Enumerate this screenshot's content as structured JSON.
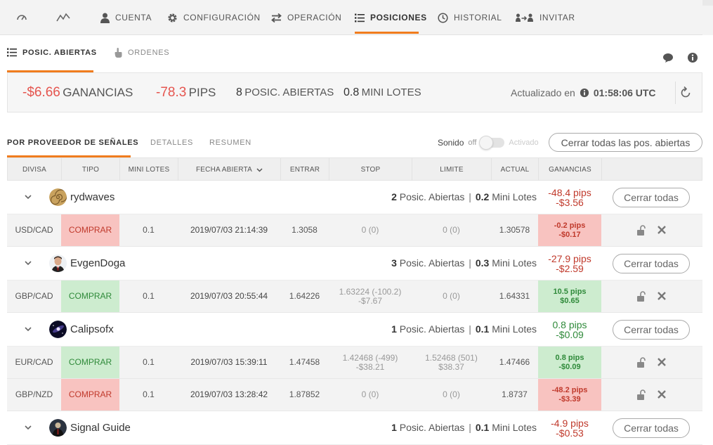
{
  "nav": {
    "items": [
      {
        "label": ""
      },
      {
        "label": ""
      },
      {
        "label": "CUENTA"
      },
      {
        "label": "CONFIGURACIÓN"
      },
      {
        "label": "OPERACIÓN"
      },
      {
        "label": "POSICIONES"
      },
      {
        "label": "HISTORIAL"
      },
      {
        "label": "INVITAR"
      }
    ]
  },
  "subtabs": {
    "open": "POSIC. ABIERTAS",
    "orders": "ORDENES"
  },
  "summary": {
    "profit_value": "-$6.66",
    "profit_label": "GANANCIAS",
    "pips_value": "-78.3",
    "pips_label": "PIPS",
    "open_count": "8",
    "open_label": "POSIC. ABIERTAS",
    "lots_value": "0.8",
    "lots_label": "MINI LOTES",
    "updated_label": "Actualizado en",
    "updated_time": "01:58:06 UTC"
  },
  "filter_tabs": {
    "by_provider": "POR PROVEEDOR DE SEÑALES",
    "details": "DETALLES",
    "summary": "RESUMEN"
  },
  "sound": {
    "label": "Sonido",
    "off": "off",
    "on": "Activado"
  },
  "close_all_open_label": "Cerrar todas las pos. abiertas",
  "columns": [
    "DIVISA",
    "TIPO",
    "MINI LOTES",
    "FECHA ABIERTA",
    "ENTRAR",
    "STOP",
    "LIMITE",
    "ACTUAL",
    "GANANCIAS"
  ],
  "close_group_label": "Cerrar todas",
  "group_text": {
    "positions": "Posic. Abiertas",
    "lots": "Mini Lotes"
  },
  "groups": [
    {
      "name": "rydwaves",
      "open": "2",
      "lots": "0.2",
      "pips": "-48.4 pips",
      "money": "-$3.56",
      "positions": [
        {
          "pair": "USD/CAD",
          "type": "COMPRAR",
          "lots": "0.1",
          "date": "2019/07/03 21:14:39",
          "entry": "1.3058",
          "stop": "0 (0)",
          "stop2": "",
          "limit": "0 (0)",
          "limit2": "",
          "current": "1.30578",
          "pips": "-0.2 pips",
          "money": "-$0.17"
        }
      ]
    },
    {
      "name": "EvgenDoga",
      "open": "3",
      "lots": "0.3",
      "pips": "-27.9 pips",
      "money": "-$2.59",
      "positions": [
        {
          "pair": "GBP/CAD",
          "type": "COMPRAR",
          "lots": "0.1",
          "date": "2019/07/03 20:55:44",
          "entry": "1.64226",
          "stop": "1.63224 (-100.2)",
          "stop2": "-$7.67",
          "limit": "0 (0)",
          "limit2": "",
          "current": "1.64331",
          "pips": "10.5 pips",
          "money": "$0.65"
        }
      ]
    },
    {
      "name": "Calipsofx",
      "open": "1",
      "lots": "0.1",
      "pips": "0.8 pips",
      "money": "-$0.09",
      "positions": [
        {
          "pair": "EUR/CAD",
          "type": "COMPRAR",
          "lots": "0.1",
          "date": "2019/07/03 15:39:11",
          "entry": "1.47458",
          "stop": "1.42468 (-499)",
          "stop2": "-$38.21",
          "limit": "1.52468 (501)",
          "limit2": "$38.37",
          "current": "1.47466",
          "pips": "0.8 pips",
          "money": "-$0.09"
        },
        {
          "pair": "GBP/NZD",
          "type": "COMPRAR",
          "lots": "0.1",
          "date": "2019/07/03 13:28:42",
          "entry": "1.87852",
          "stop": "0 (0)",
          "stop2": "",
          "limit": "0 (0)",
          "limit2": "",
          "current": "1.8737",
          "pips": "-48.2 pips",
          "money": "-$3.39"
        }
      ]
    },
    {
      "name": "Signal Guide",
      "open": "1",
      "lots": "0.1",
      "pips": "-4.9 pips",
      "money": "-$0.53",
      "positions": []
    }
  ]
}
